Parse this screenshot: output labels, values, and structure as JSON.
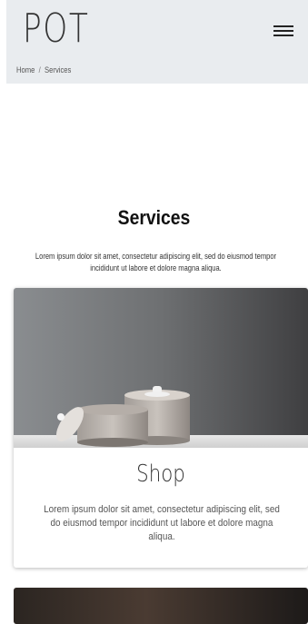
{
  "header": {
    "logo_text": "POT",
    "menu_icon": "hamburger-menu-icon"
  },
  "breadcrumb": {
    "home": "Home",
    "separator": "/",
    "current": "Services"
  },
  "section": {
    "title": "Services",
    "description": "Lorem ipsum dolor sit amet, consectetur adipiscing elit, sed do eiusmod tempor incididunt ut labore et dolore magna aliqua."
  },
  "cards": [
    {
      "title": "Shop",
      "text": "Lorem ipsum dolor sit amet, consectetur adipiscing elit, sed do eiusmod tempor incididunt ut labore et dolore magna aliqua."
    }
  ],
  "colors": {
    "header_bg": "#e9ecef",
    "text_dark": "#111111"
  }
}
